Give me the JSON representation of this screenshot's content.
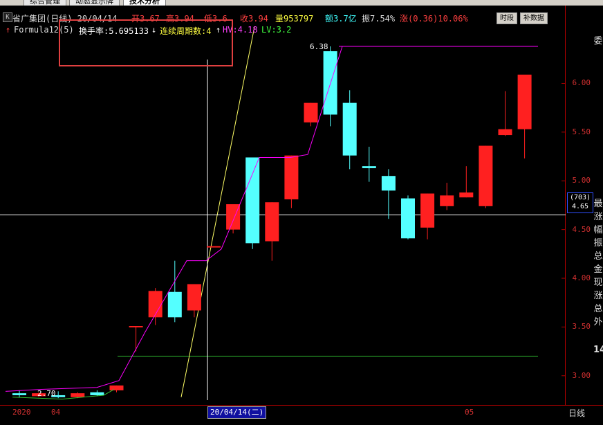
{
  "tabs": [
    {
      "label": "综合管理",
      "active": false
    },
    {
      "label": "动态显示牌",
      "active": false
    },
    {
      "label": "技术分析",
      "active": true
    }
  ],
  "header": {
    "k_btn": "K",
    "stock_line": "省广集团(日线) 20/04/14",
    "open": "开3.67",
    "high": "高3.94",
    "low": "低3.6",
    "close": "收3.94",
    "volume": "量953797",
    "amount": "额3.7亿",
    "amplitude": "振7.54%",
    "change": "涨(0.36)10.06%",
    "btn_time": "时段",
    "btn_restore": "补数据"
  },
  "formula": {
    "name": "Formula12(5)",
    "turnover": "换手率:5.695133",
    "continuous": "连续周期数:4",
    "hv": "HV:4.18",
    "lv": "LV:3.2"
  },
  "chart_data": {
    "type": "candlestick",
    "ylim": [
      2.75,
      6.6
    ],
    "y_ticks": [
      "6.00",
      "5.50",
      "5.00",
      "4.50",
      "4.00",
      "3.50",
      "3.00"
    ],
    "candles": [
      {
        "o": 2.82,
        "h": 2.85,
        "l": 2.78,
        "c": 2.8
      },
      {
        "o": 2.79,
        "h": 2.83,
        "l": 2.78,
        "c": 2.82
      },
      {
        "o": 2.8,
        "h": 2.84,
        "l": 2.77,
        "c": 2.78
      },
      {
        "o": 2.78,
        "h": 2.83,
        "l": 2.77,
        "c": 2.82
      },
      {
        "o": 2.83,
        "h": 2.85,
        "l": 2.79,
        "c": 2.8
      },
      {
        "o": 2.85,
        "h": 2.9,
        "l": 2.83,
        "c": 2.9
      },
      {
        "o": 3.51,
        "h": 3.51,
        "l": 3.25,
        "c": 3.51
      },
      {
        "o": 3.6,
        "h": 3.9,
        "l": 3.52,
        "c": 3.87
      },
      {
        "o": 3.86,
        "h": 4.18,
        "l": 3.55,
        "c": 3.6
      },
      {
        "o": 3.67,
        "h": 3.94,
        "l": 3.6,
        "c": 3.94
      },
      {
        "o": 4.33,
        "h": 4.33,
        "l": 4.33,
        "c": 4.33
      },
      {
        "o": 4.5,
        "h": 4.75,
        "l": 4.46,
        "c": 4.76
      },
      {
        "o": 5.24,
        "h": 5.24,
        "l": 4.3,
        "c": 4.36
      },
      {
        "o": 4.38,
        "h": 4.78,
        "l": 4.18,
        "c": 4.78
      },
      {
        "o": 4.81,
        "h": 5.26,
        "l": 4.72,
        "c": 5.26
      },
      {
        "o": 5.6,
        "h": 5.8,
        "l": 5.56,
        "c": 5.8
      },
      {
        "o": 6.33,
        "h": 6.38,
        "l": 5.56,
        "c": 5.68
      },
      {
        "o": 5.8,
        "h": 5.93,
        "l": 5.12,
        "c": 5.26
      },
      {
        "o": 5.15,
        "h": 5.35,
        "l": 4.99,
        "c": 5.13
      },
      {
        "o": 5.05,
        "h": 5.12,
        "l": 4.61,
        "c": 4.9
      },
      {
        "o": 4.82,
        "h": 4.85,
        "l": 4.4,
        "c": 4.41
      },
      {
        "o": 4.52,
        "h": 4.87,
        "l": 4.4,
        "c": 4.87
      },
      {
        "o": 4.74,
        "h": 4.98,
        "l": 4.7,
        "c": 4.85
      },
      {
        "o": 4.83,
        "h": 5.15,
        "l": 4.83,
        "c": 4.88
      },
      {
        "o": 4.74,
        "h": 5.36,
        "l": 4.72,
        "c": 5.36
      },
      {
        "o": 5.47,
        "h": 5.92,
        "l": 5.46,
        "c": 5.53
      },
      {
        "o": 5.53,
        "h": 6.08,
        "l": 5.23,
        "c": 6.09
      }
    ],
    "annotations": [
      {
        "label": "6.38",
        "value": 6.38
      },
      {
        "label": "2.70",
        "value": 2.82
      }
    ],
    "hv": 4.18,
    "lv": 3.2,
    "crosshair_price": 4.65
  },
  "price_tag": {
    "line1": "(703)",
    "line2": "4.65"
  },
  "xaxis": {
    "labels": [
      "2020",
      "04",
      "05"
    ],
    "selected": "20/04/14(二)",
    "period": "日线"
  },
  "right_panel_chars": [
    "委",
    "",
    "",
    "",
    "最",
    "涨",
    "幅",
    "振",
    "总",
    "金",
    "现",
    "涨",
    "总",
    "外",
    "",
    "14"
  ],
  "colors": {
    "up": "#ff2020",
    "down": "#54ffff",
    "ma": "#ff00ff",
    "trend": "#ffff66",
    "lv_line": "#30c030"
  }
}
